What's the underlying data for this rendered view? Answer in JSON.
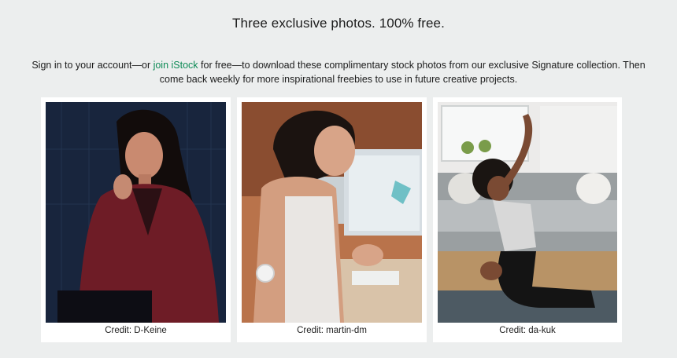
{
  "header": {
    "title": "Three exclusive photos. 100% free."
  },
  "intro": {
    "text_before": "Sign in to your account—or ",
    "link_label": "join iStock",
    "text_after": " for free—to download these complimentary stock photos from our exclusive Signature collection. Then come back weekly for more inspirational freebies to use in future creative projects."
  },
  "photos": [
    {
      "credit": "Credit: D-Keine",
      "subject": "woman-in-red-leather-jacket"
    },
    {
      "credit": "Credit: martin-dm",
      "subject": "woman-with-glucose-sensor"
    },
    {
      "credit": "Credit: da-kuk",
      "subject": "woman-stretching-yoga"
    }
  ],
  "colors": {
    "background": "#eceeee",
    "link": "#0c8a55",
    "card": "#ffffff"
  }
}
